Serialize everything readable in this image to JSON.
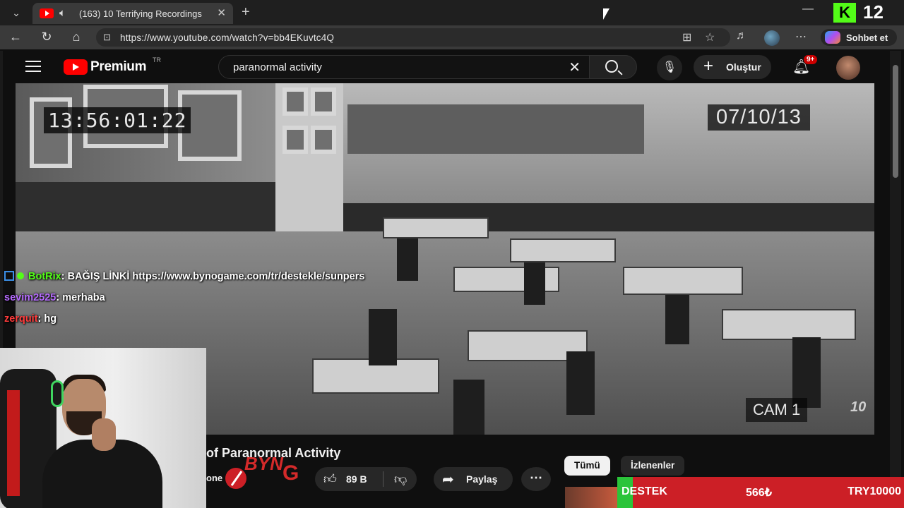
{
  "browser": {
    "tab_title": "(163) 10 Terrifying Recordings",
    "url": "https://www.youtube.com/watch?v=bb4EKuvtc4Q",
    "copilot_label": "Sohbet et"
  },
  "overlay": {
    "viewer_count": "12"
  },
  "youtube": {
    "logo_text": "Premium",
    "logo_region": "TR",
    "search_query": "paranormal activity",
    "create_label": "Oluştur",
    "notification_count": "9+"
  },
  "video": {
    "timecode": "13:56:01:22",
    "date": "07/10/13",
    "camera": "CAM 1",
    "watermark": "10",
    "title": "of Paranormal Activity",
    "channel_stub": "one"
  },
  "chat": [
    {
      "user": "BotRix",
      "user_color": "#53fc18",
      "message": ": BAĞIŞ LİNKİ https://www.bynogame.com/tr/destekle/sunpers"
    },
    {
      "user": "sevim2525",
      "user_color": "#b66cff",
      "message": ": merhaba"
    },
    {
      "user": "zerquit",
      "user_color": "#ff3b3b",
      "message": ": hg"
    }
  ],
  "actions": {
    "like_count": "89 B",
    "share_label": "Paylaş"
  },
  "chips": {
    "all": "Tümü",
    "watched": "İzlenenler"
  },
  "donation": {
    "label": "DESTEK",
    "amount": "566₺",
    "goal": "TRY10000"
  },
  "colors": {
    "youtube_red": "#ff0000",
    "kick_green": "#53fc18",
    "donation_red": "#cc1f26",
    "donation_green": "#2bc43a"
  }
}
